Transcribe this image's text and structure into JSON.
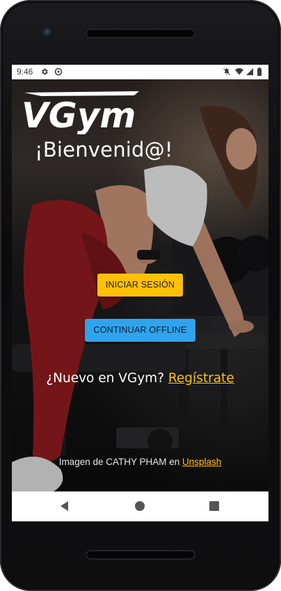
{
  "status_bar": {
    "time": "9:46",
    "left_icons": [
      "gear-icon",
      "app-sync-icon"
    ],
    "right_icons": [
      "mute-icon",
      "wifi-icon",
      "signal-icon",
      "battery-icon"
    ]
  },
  "app": {
    "logo_text": "VGym",
    "welcome_text": "¡Bienvenid@!"
  },
  "buttons": {
    "login_label": "INICIAR SESIÓN",
    "offline_label": "CONTINUAR OFFLINE"
  },
  "register": {
    "prompt": "¿Nuevo en VGym?",
    "link_label": "Regístrate"
  },
  "credit": {
    "text": "Imagen de CATHY PHAM en",
    "link_label": "Unsplash"
  },
  "colors": {
    "accent_yellow": "#ffc107",
    "accent_blue": "#2ea4ef"
  },
  "nav_icons": [
    "back-icon",
    "home-icon",
    "recents-icon"
  ]
}
